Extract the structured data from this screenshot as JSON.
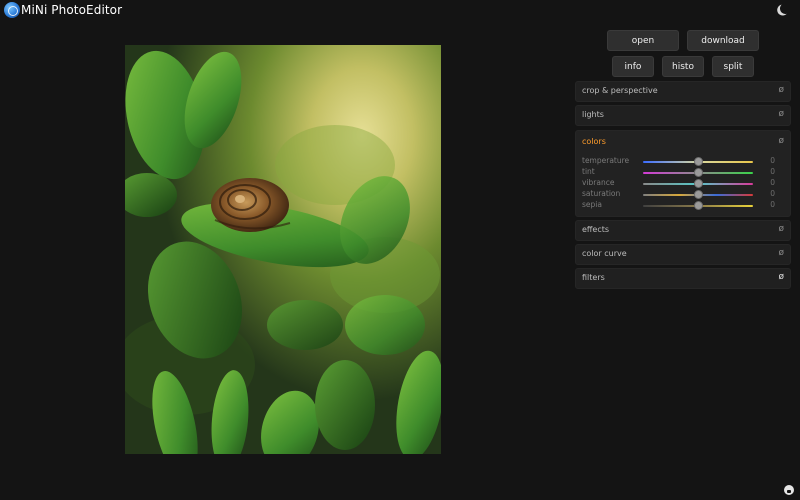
{
  "header": {
    "title": "MiNi PhotoEditor",
    "theme_icon": "moon-icon",
    "logo_icon": "camera-lens-logo"
  },
  "toolbar": {
    "open_label": "open",
    "download_label": "download",
    "info_label": "info",
    "histo_label": "histo",
    "split_label": "split"
  },
  "sections": {
    "crop": {
      "title": "crop & perspective",
      "icon": "ø"
    },
    "lights": {
      "title": "lights",
      "icon": "ø"
    },
    "colors": {
      "title": "colors",
      "icon": "ø",
      "accent": "#ff9d2c",
      "sliders": [
        {
          "label": "temperature",
          "value": "0",
          "level": 0.5
        },
        {
          "label": "tint",
          "value": "0",
          "level": 0.5
        },
        {
          "label": "vibrance",
          "value": "0",
          "level": 0.5
        },
        {
          "label": "saturation",
          "value": "0",
          "level": 0.5
        },
        {
          "label": "sepia",
          "value": "0",
          "level": 0.5
        }
      ]
    },
    "effects": {
      "title": "effects",
      "icon": "ø"
    },
    "color_curve": {
      "title": "color curve",
      "icon": "ø"
    },
    "filters": {
      "title": "filters",
      "icon": "ø"
    }
  },
  "image": {
    "subject": "photo"
  },
  "footer": {
    "icon": "github-icon"
  }
}
